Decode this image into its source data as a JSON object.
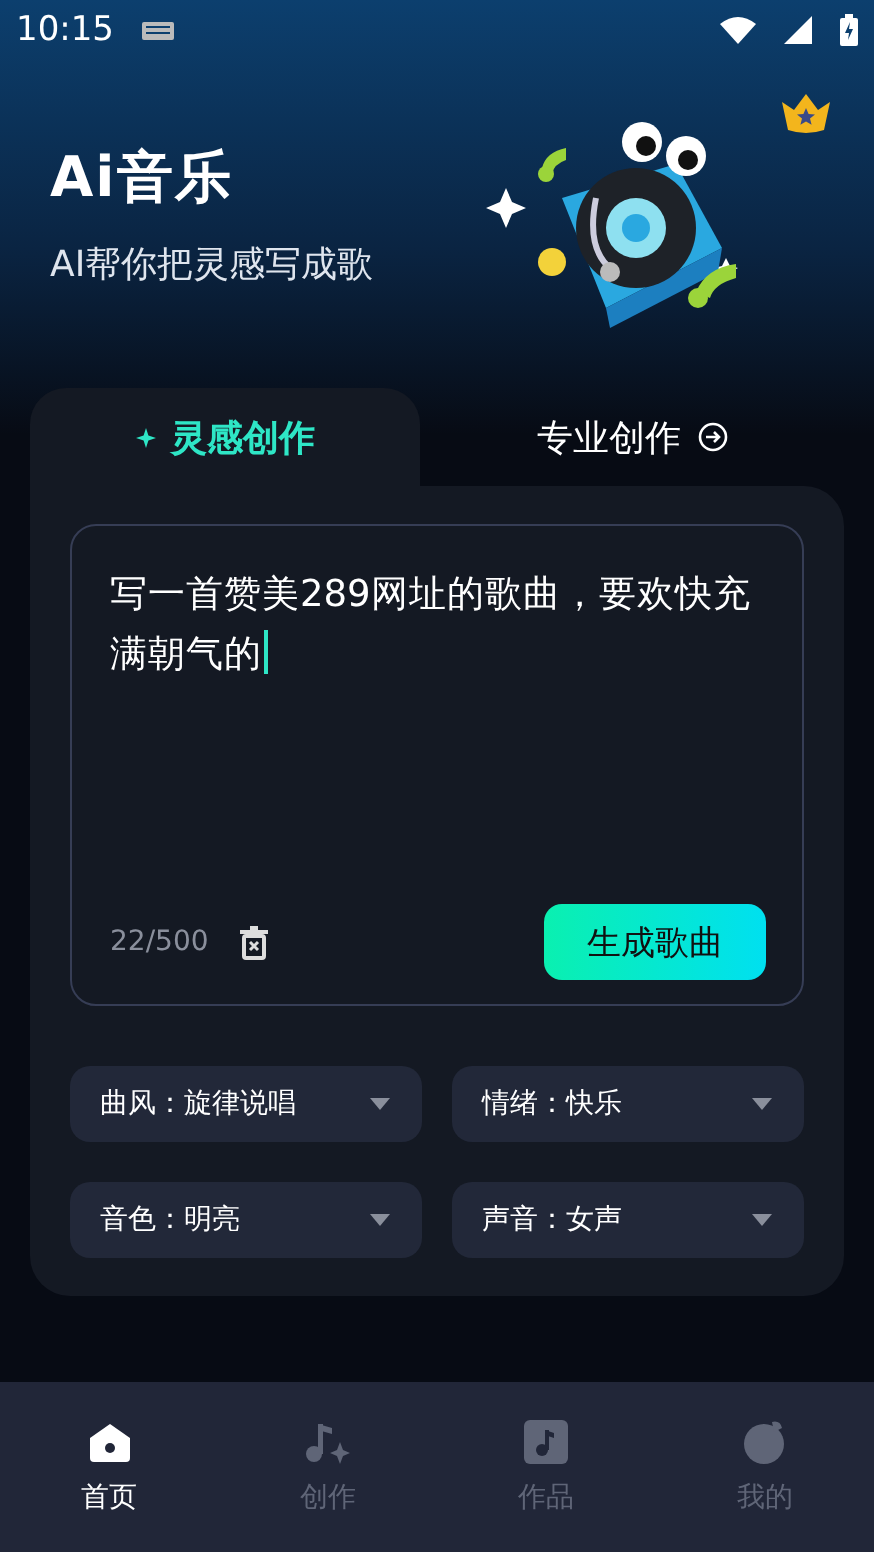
{
  "status_bar": {
    "time": "10:15"
  },
  "header": {
    "title": "Ai音乐",
    "subtitle": "AI帮你把灵感写成歌"
  },
  "tabs": [
    {
      "label": "灵感创作",
      "selected": true
    },
    {
      "label": "专业创作",
      "selected": false
    }
  ],
  "prompt": {
    "value": "写一首赞美289网址的歌曲，要欢快充满朝气的",
    "counter": "22/500",
    "button": "生成歌曲"
  },
  "options": [
    {
      "label": "曲风：旋律说唱"
    },
    {
      "label": "情绪：快乐"
    },
    {
      "label": "音色：明亮"
    },
    {
      "label": "声音：女声"
    }
  ],
  "nav": [
    {
      "label": "首页",
      "kind": "home",
      "selected": true
    },
    {
      "label": "创作",
      "kind": "create",
      "selected": false
    },
    {
      "label": "作品",
      "kind": "works",
      "selected": false
    },
    {
      "label": "我的",
      "kind": "me",
      "selected": false
    }
  ]
}
